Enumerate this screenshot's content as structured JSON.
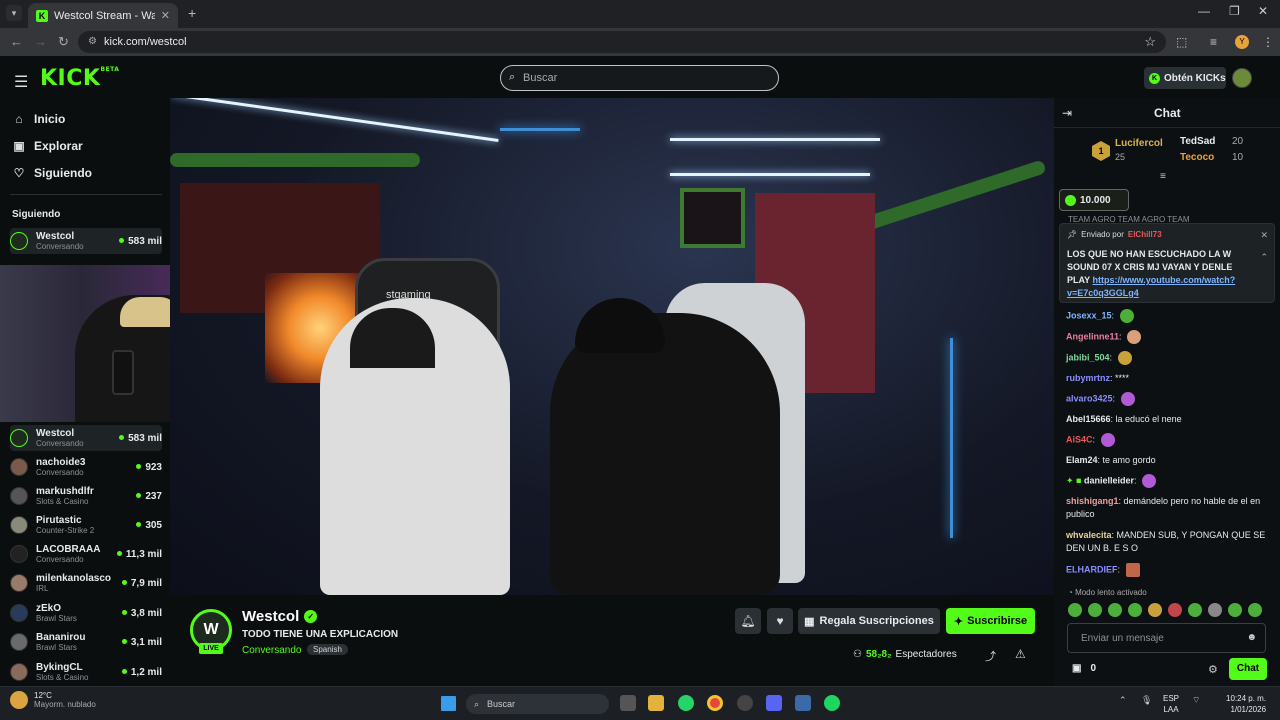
{
  "browser": {
    "tab_title": "Westcol Stream - Watch Li",
    "url": "kick.com/westcol",
    "profile_initial": "Y"
  },
  "header": {
    "logo": "KICK",
    "logo_badge": "BETA",
    "search_placeholder": "Buscar",
    "get_kicks_label": "Obtén KICKs"
  },
  "sidebar": {
    "nav": [
      {
        "label": "Inicio",
        "icon": "home-icon"
      },
      {
        "label": "Explorar",
        "icon": "compass-icon"
      },
      {
        "label": "Siguiendo",
        "icon": "heart-icon"
      }
    ],
    "following_title": "Siguiendo",
    "channels": [
      {
        "name": "Westcol",
        "category": "Conversando",
        "viewers": "583 mil"
      },
      {
        "name": "Westcol",
        "category": "Conversando",
        "viewers": "583 mil"
      },
      {
        "name": "nachoide3",
        "category": "Conversando",
        "viewers": "923"
      },
      {
        "name": "markushdlfr",
        "category": "Slots & Casino",
        "viewers": "237"
      },
      {
        "name": "Pirutastic",
        "category": "Counter-Strike 2",
        "viewers": "305"
      },
      {
        "name": "LACOBRAAA",
        "category": "Conversando",
        "viewers": "11,3 mil"
      },
      {
        "name": "milenkanolasco",
        "category": "IRL",
        "viewers": "7,9 mil"
      },
      {
        "name": "zEkO",
        "category": "Brawl Stars",
        "viewers": "3,8 mil"
      },
      {
        "name": "Bananirou",
        "category": "Brawl Stars",
        "viewers": "3,1 mil"
      },
      {
        "name": "BykingCL",
        "category": "Slots & Casino",
        "viewers": "1,2 mil"
      }
    ]
  },
  "stream": {
    "channel": "Westcol",
    "live_label": "LIVE",
    "title": "TODO TIENE UNA EXPLICACION",
    "category": "Conversando",
    "language_tag": "Spanish",
    "gift_label": "Regala Suscripciones",
    "subscribe_label": "Suscribirse",
    "viewers_num": "58₂8₂",
    "viewers_label": "Espectadores",
    "scene_chair_brand": "stgaming"
  },
  "chat": {
    "title": "Chat",
    "leaderboard": [
      {
        "name": "Lucifercol",
        "count": "25",
        "rank": "1"
      },
      {
        "name": "TedSad",
        "count": "20"
      },
      {
        "name": "Tecoco",
        "count": "10"
      }
    ],
    "kicks_amount": "10.000",
    "team_row": "TEAM AGRO  TEAM AGRO  TEAM",
    "pinned_by_label": "Enviado por",
    "pinned_by_user": "ElChill73",
    "pinned_text": "LOS QUE NO HAN ESCUCHADO LA W SOUND 07 X CRIS MJ VAYAN Y DENLE PLAY",
    "pinned_link": "https://www.youtube.com/watch?v=E7c0q3GGLg4",
    "messages": [
      {
        "user": "Josexx_15",
        "text": "",
        "color": "#7fb4ff"
      },
      {
        "user": "Angelinne11",
        "text": "",
        "color": "#e87fa0"
      },
      {
        "user": "jabibi_504",
        "text": "",
        "color": "#7fd6a0"
      },
      {
        "user": "rubymrtnz",
        "text": "****",
        "color": "#8a8cff"
      },
      {
        "user": "alvaro3425",
        "text": "",
        "color": "#8a8cff"
      },
      {
        "user": "Abel15666",
        "text": "la educó el nene",
        "color": "#e8eaed"
      },
      {
        "user": "AiS4C",
        "text": "",
        "color": "#e8575a"
      },
      {
        "user": "Elam24",
        "text": "te amo gordo",
        "color": "#e8eaed"
      },
      {
        "user": "danielleider",
        "text": "",
        "color": "#e8eaed"
      },
      {
        "user": "shishigang1",
        "text": "demándelo pero no hable de el en publico",
        "color": "#e8a0a0"
      },
      {
        "user": "whvalecita",
        "text": "MANDEN SUB, Y PONGAN QUE SE DEN UN B. E S O",
        "color": "#e8d0a0"
      },
      {
        "user": "ELHARDIEF",
        "text": "",
        "color": "#8a8cff"
      }
    ],
    "slow_mode": "Modo lento activado",
    "input_placeholder": "Enviar un mensaje",
    "points": "0",
    "send_label": "Chat"
  },
  "taskbar": {
    "temp": "12°C",
    "weather": "Mayorm. nublado",
    "search_label": "Buscar",
    "lang1": "ESP",
    "lang2": "LAA",
    "time": "10:24 p. m.",
    "date": "1/01/2026"
  }
}
